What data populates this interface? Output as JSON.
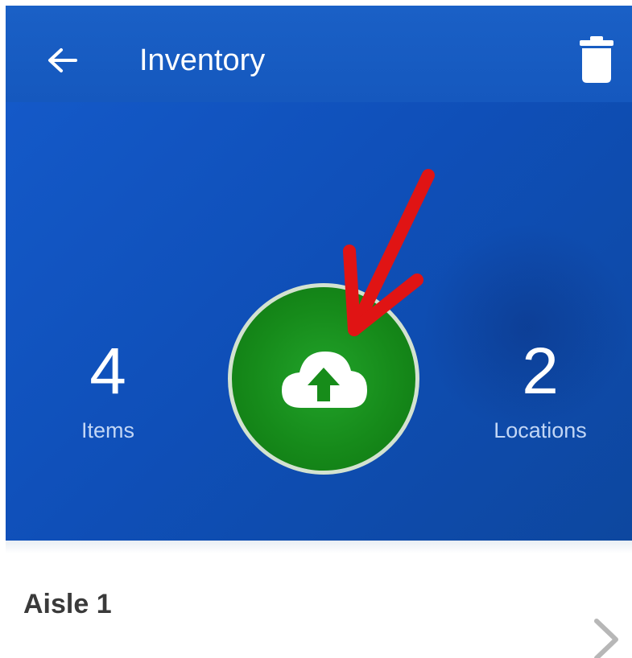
{
  "app_bar": {
    "title": "Inventory",
    "back_icon": "arrow-back-icon",
    "delete_icon": "trash-icon"
  },
  "summary": {
    "items_count": "4",
    "items_label": "Items",
    "locations_count": "2",
    "locations_label": "Locations",
    "sync_icon": "cloud-upload-icon"
  },
  "annotation": {
    "icon": "red-arrow-icon",
    "color": "#e01414"
  },
  "locations_list": [
    {
      "label": "Aisle 1",
      "icon": "chevron-right-icon"
    }
  ],
  "colors": {
    "primary": "#1558be",
    "sync_green": "#168a1a",
    "annotation_red": "#e01414"
  }
}
